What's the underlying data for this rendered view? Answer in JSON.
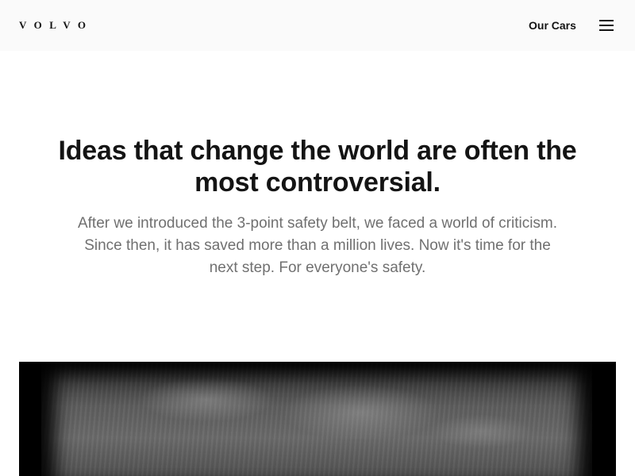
{
  "header": {
    "logo": "VOLVO",
    "nav_link": "Our Cars",
    "menu_icon": "hamburger-menu-icon"
  },
  "hero": {
    "title": "Ideas that change the world are often the most controversial.",
    "body": "After we introduced the 3-point safety belt, we faced a world of criticism. Since then, it has saved more than a million lives. Now it's time for the next step. For everyone's safety."
  },
  "colors": {
    "header_bg": "#fafafa",
    "text_primary": "#141414",
    "text_secondary": "#707070"
  }
}
